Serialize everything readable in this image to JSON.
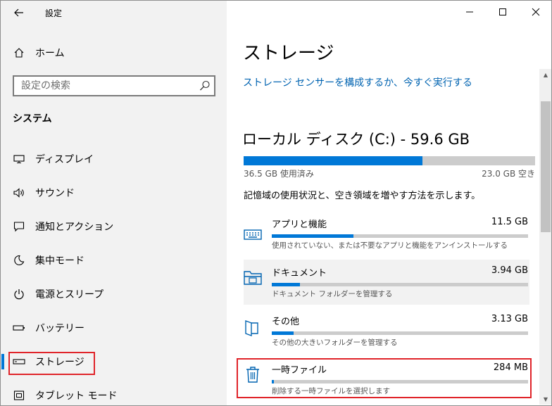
{
  "window": {
    "title": "設定"
  },
  "colors": {
    "accent": "#0078d7",
    "highlight_red": "#e0242a",
    "link": "#0063b1",
    "bar_track": "#cccccc"
  },
  "nav": {
    "back_icon": "back-arrow-icon",
    "home_label": "ホーム",
    "search": {
      "placeholder": "設定の検索",
      "value": ""
    },
    "section_title": "システム",
    "items": [
      {
        "label": "ディスプレイ",
        "icon": "display-icon"
      },
      {
        "label": "サウンド",
        "icon": "speaker-icon"
      },
      {
        "label": "通知とアクション",
        "icon": "notification-icon"
      },
      {
        "label": "集中モード",
        "icon": "moon-icon"
      },
      {
        "label": "電源とスリープ",
        "icon": "power-icon"
      },
      {
        "label": "バッテリー",
        "icon": "battery-icon"
      },
      {
        "label": "ストレージ",
        "icon": "storage-icon",
        "selected": true
      },
      {
        "label": "タブレット モード",
        "icon": "tablet-icon"
      }
    ]
  },
  "main": {
    "title": "ストレージ",
    "sense_link": "ストレージ センサーを構成するか、今すぐ実行する",
    "disk": {
      "name": "ローカル ディスク (C:) - 59.6 GB",
      "used_fraction": 0.613,
      "used_text": "36.5 GB 使用済み",
      "free_text": "23.0 GB 空き"
    },
    "description": "記憶域の使用状況と、空き領域を増やす方法を示します。",
    "categories": [
      {
        "name": "アプリと機能",
        "size": "11.5 GB",
        "fraction": 0.32,
        "sub": "使用されていない、または不要なアプリと機能をアンインストールする",
        "icon": "keyboard-icon"
      },
      {
        "name": "ドキュメント",
        "size": "3.94 GB",
        "fraction": 0.11,
        "sub": "ドキュメント フォルダーを管理する",
        "icon": "documents-folder-icon"
      },
      {
        "name": "その他",
        "size": "3.13 GB",
        "fraction": 0.085,
        "sub": "その他の大きいフォルダーを管理する",
        "icon": "open-folder-icon"
      },
      {
        "name": "一時ファイル",
        "size": "284 MB",
        "fraction": 0.008,
        "sub": "削除する一時ファイルを選択します",
        "icon": "trash-icon"
      }
    ]
  }
}
